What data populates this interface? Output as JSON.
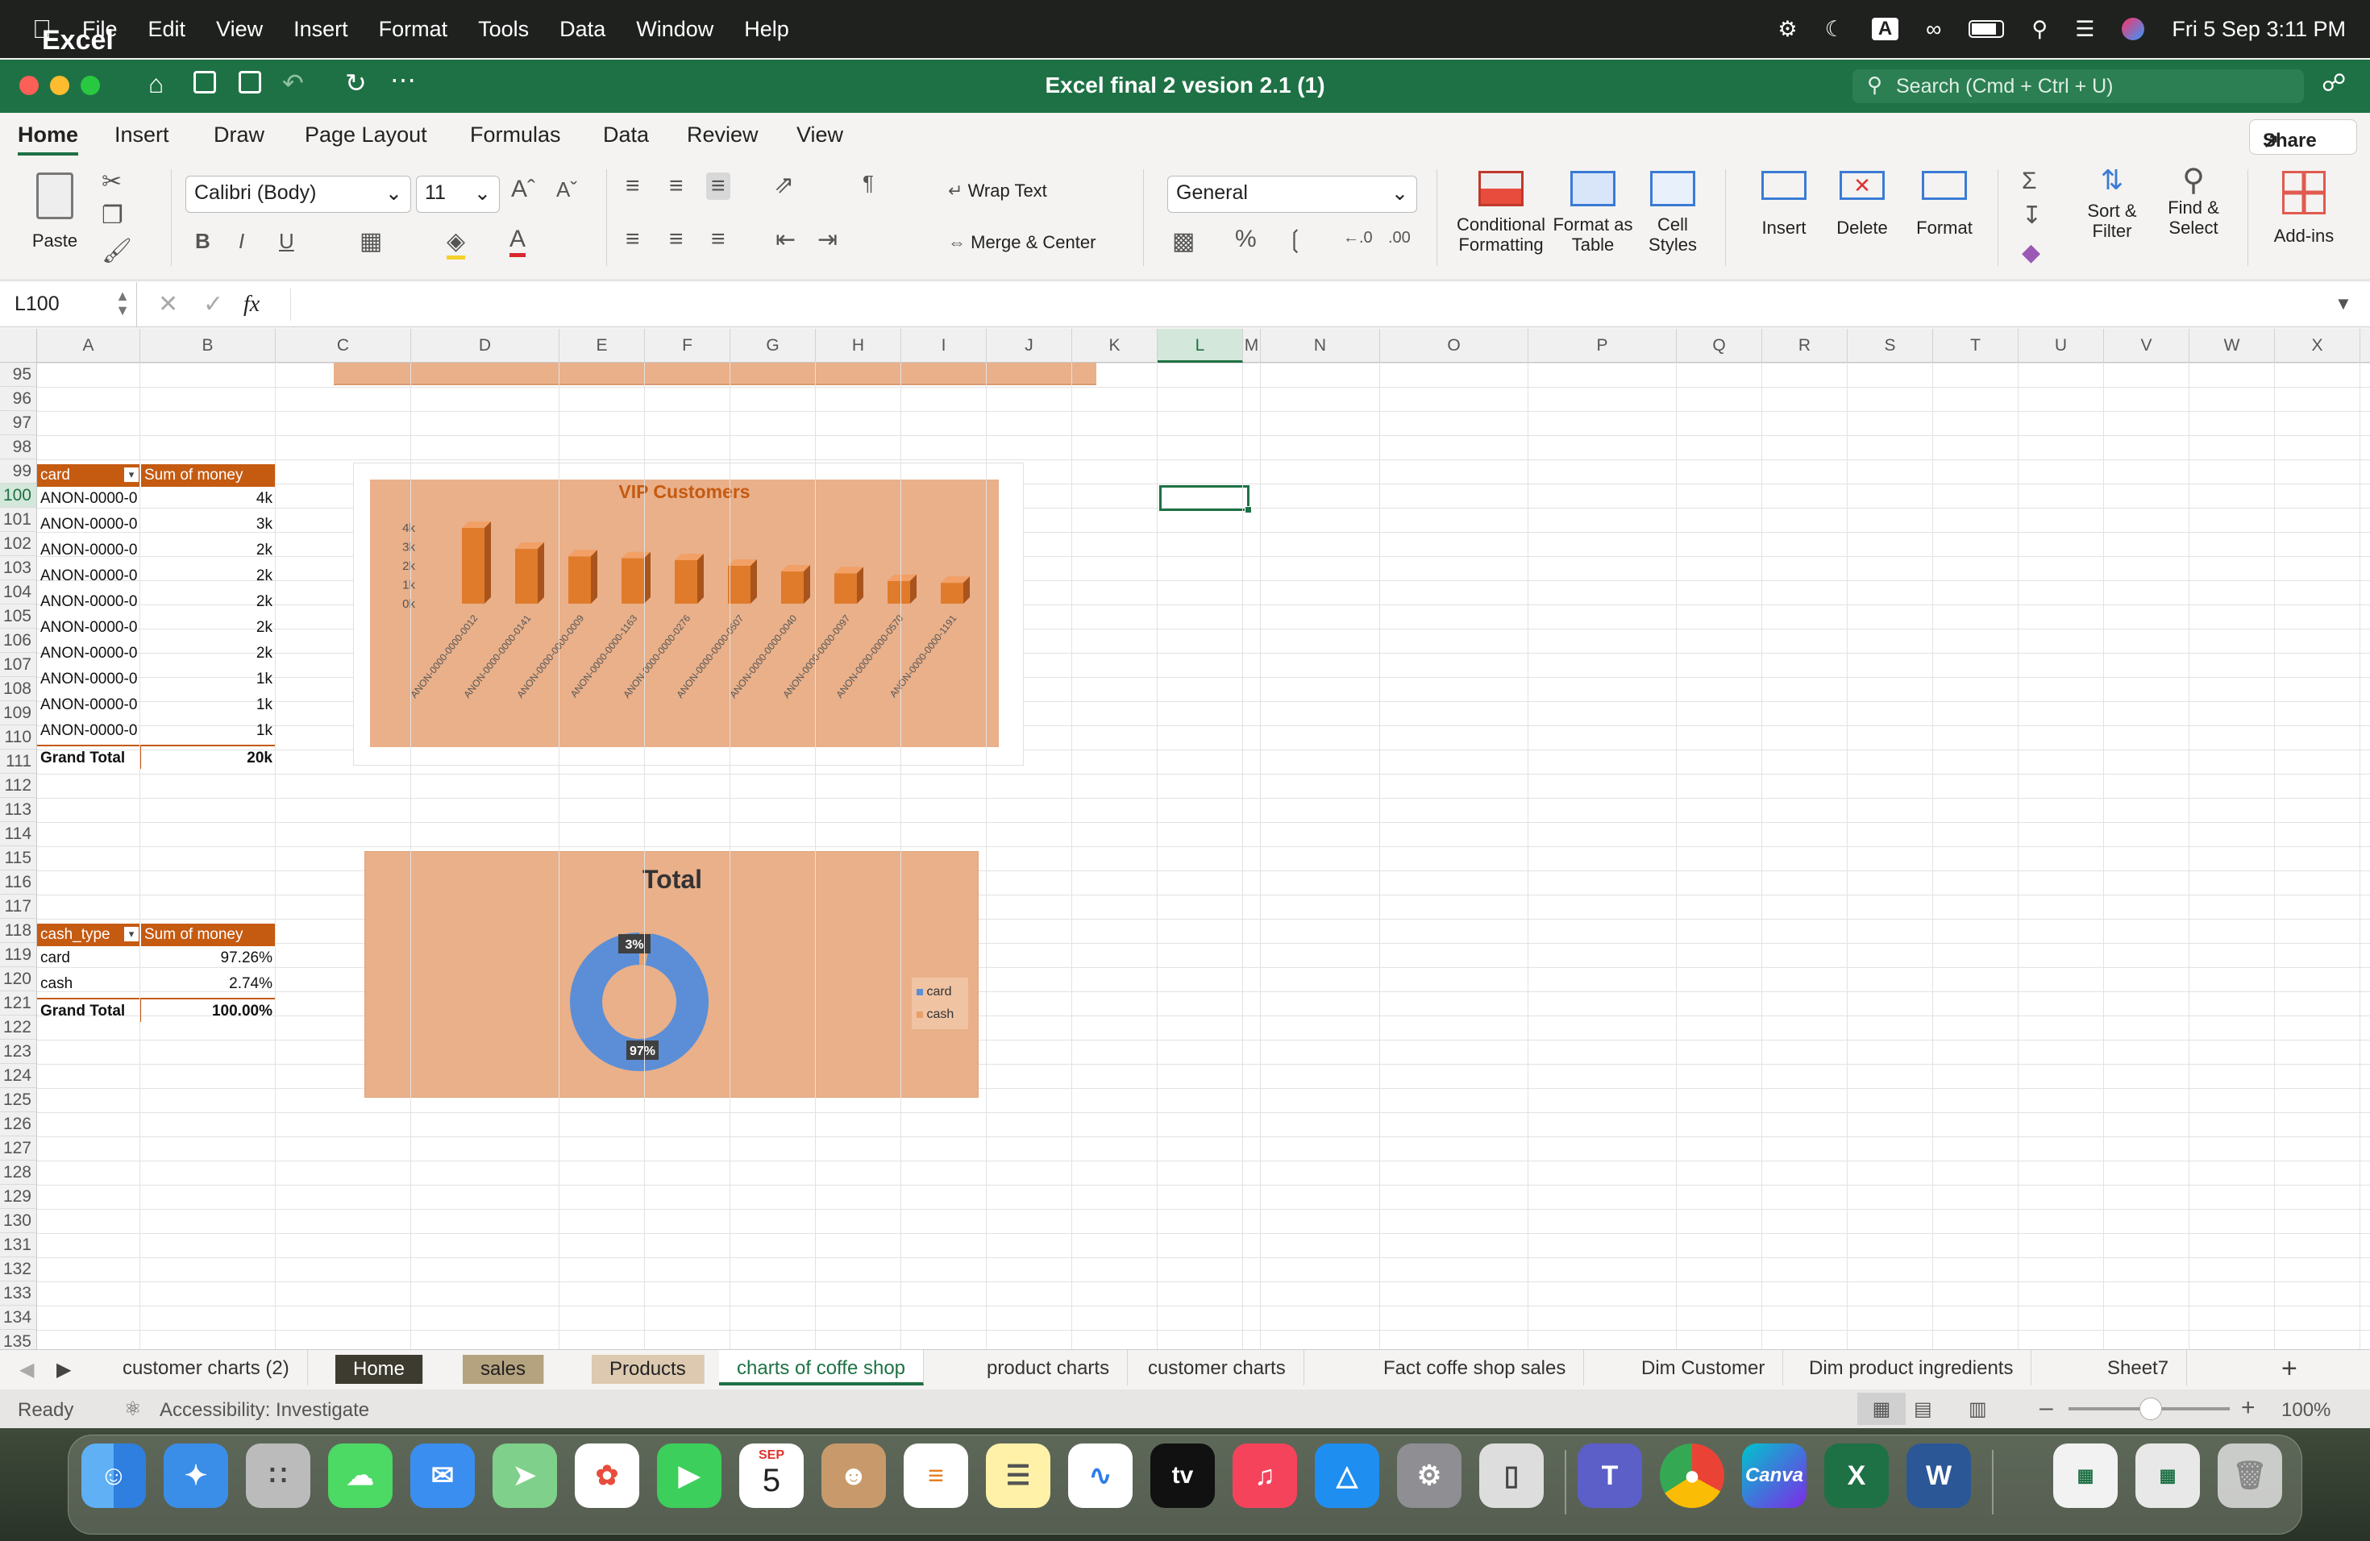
{
  "menubar": {
    "app_name": "Excel",
    "items": [
      "File",
      "Edit",
      "View",
      "Insert",
      "Format",
      "Tools",
      "Data",
      "Window",
      "Help"
    ],
    "input_source": "A",
    "datetime": "Fri 5 Sep  3:11 PM"
  },
  "window": {
    "title": "Excel final 2 vesion 2.1 (1)",
    "search_placeholder": "Search (Cmd + Ctrl + U)"
  },
  "ribbon": {
    "tabs": [
      "Home",
      "Insert",
      "Draw",
      "Page Layout",
      "Formulas",
      "Data",
      "Review",
      "View"
    ],
    "active_tab": "Home",
    "share_label": "Share",
    "paste_label": "Paste",
    "font_name": "Calibri (Body)",
    "font_size": "11",
    "wrap_text": "Wrap Text",
    "merge_center": "Merge & Center",
    "number_format": "General",
    "conditional_formatting": "Conditional Formatting",
    "format_as_table": "Format as Table",
    "cell_styles": "Cell Styles",
    "insert": "Insert",
    "delete": "Delete",
    "format": "Format",
    "sort_filter": "Sort & Filter",
    "find_select": "Find & Select",
    "add_ins": "Add-ins"
  },
  "formula_bar": {
    "name_box": "L100",
    "fx": "fx",
    "value": ""
  },
  "columns": [
    "A",
    "B",
    "C",
    "D",
    "E",
    "F",
    "G",
    "H",
    "I",
    "J",
    "K",
    "L",
    "M",
    "N",
    "O",
    "P",
    "Q",
    "R",
    "S",
    "T",
    "U",
    "V",
    "W",
    "X"
  ],
  "selected_column": "L",
  "rows": [
    "95",
    "96",
    "97",
    "98",
    "99",
    "100",
    "101",
    "102",
    "103",
    "104",
    "105",
    "106",
    "107",
    "108",
    "109",
    "110",
    "111",
    "112",
    "113",
    "114",
    "115",
    "116",
    "117",
    "118",
    "119",
    "120",
    "121",
    "122",
    "123",
    "124",
    "125",
    "126",
    "127",
    "128",
    "129",
    "130",
    "131",
    "132",
    "133",
    "134",
    "135"
  ],
  "pivot_vip": {
    "header_a": "card",
    "header_b": "Sum of money",
    "rows": [
      {
        "card": "ANON-0000-0",
        "money": "4k"
      },
      {
        "card": "ANON-0000-0",
        "money": "3k"
      },
      {
        "card": "ANON-0000-0",
        "money": "2k"
      },
      {
        "card": "ANON-0000-0",
        "money": "2k"
      },
      {
        "card": "ANON-0000-0",
        "money": "2k"
      },
      {
        "card": "ANON-0000-0",
        "money": "2k"
      },
      {
        "card": "ANON-0000-0",
        "money": "2k"
      },
      {
        "card": "ANON-0000-0",
        "money": "1k"
      },
      {
        "card": "ANON-0000-0",
        "money": "1k"
      },
      {
        "card": "ANON-0000-0",
        "money": "1k"
      }
    ],
    "total_label": "Grand Total",
    "total_value": "20k"
  },
  "pivot_cash": {
    "header_a": "cash_type",
    "header_b": "Sum of money",
    "rows": [
      {
        "type": "card",
        "pct": "97.26%"
      },
      {
        "type": "cash",
        "pct": "2.74%"
      }
    ],
    "total_label": "Grand Total",
    "total_value": "100.00%"
  },
  "chart_data": [
    {
      "type": "bar",
      "title": "VIP Customers",
      "categories": [
        "ANON-0000-0000-0012",
        "ANON-0000-0000-0141",
        "ANON-0000-0000-0009",
        "ANON-0000-0000-1163",
        "ANON-0000-0000-0276",
        "ANON-0000-0000-0507",
        "ANON-0000-0000-0040",
        "ANON-0000-0000-0097",
        "ANON-0000-0000-0570",
        "ANON-0000-0000-1191"
      ],
      "values": [
        4000,
        2900,
        2500,
        2400,
        2300,
        2000,
        1700,
        1600,
        1200,
        1100
      ],
      "ylim": [
        0,
        4000
      ],
      "yticks": [
        "4k",
        "3k",
        "2k",
        "1k",
        "0k"
      ],
      "color": "#e07b2c"
    },
    {
      "type": "pie",
      "title": "Total",
      "categories": [
        "card",
        "cash"
      ],
      "values": [
        97.26,
        2.74
      ],
      "labels": [
        "97%",
        "3%"
      ],
      "colors": [
        "#5b8ed6",
        "#e8a06a"
      ],
      "legend": "right"
    }
  ],
  "sheets": {
    "tabs": [
      {
        "label": "customer charts (2)",
        "style": "plain"
      },
      {
        "label": "Home",
        "style": "dark"
      },
      {
        "label": "sales",
        "style": "tan"
      },
      {
        "label": "Products",
        "style": "light"
      },
      {
        "label": "charts of coffe shop",
        "style": "active"
      },
      {
        "label": "product charts",
        "style": "plain"
      },
      {
        "label": "customer charts",
        "style": "plain"
      },
      {
        "label": "Fact coffe shop sales",
        "style": "plain"
      },
      {
        "label": "Dim Customer",
        "style": "plain"
      },
      {
        "label": "Dim product ingredients",
        "style": "plain"
      },
      {
        "label": "Sheet7",
        "style": "plain"
      }
    ]
  },
  "status": {
    "ready": "Ready",
    "accessibility": "Accessibility: Investigate",
    "zoom": "100%"
  },
  "dock": {
    "calendar_month": "SEP",
    "calendar_day": "5",
    "tv_label": "tv",
    "canva_label": "Canva"
  }
}
